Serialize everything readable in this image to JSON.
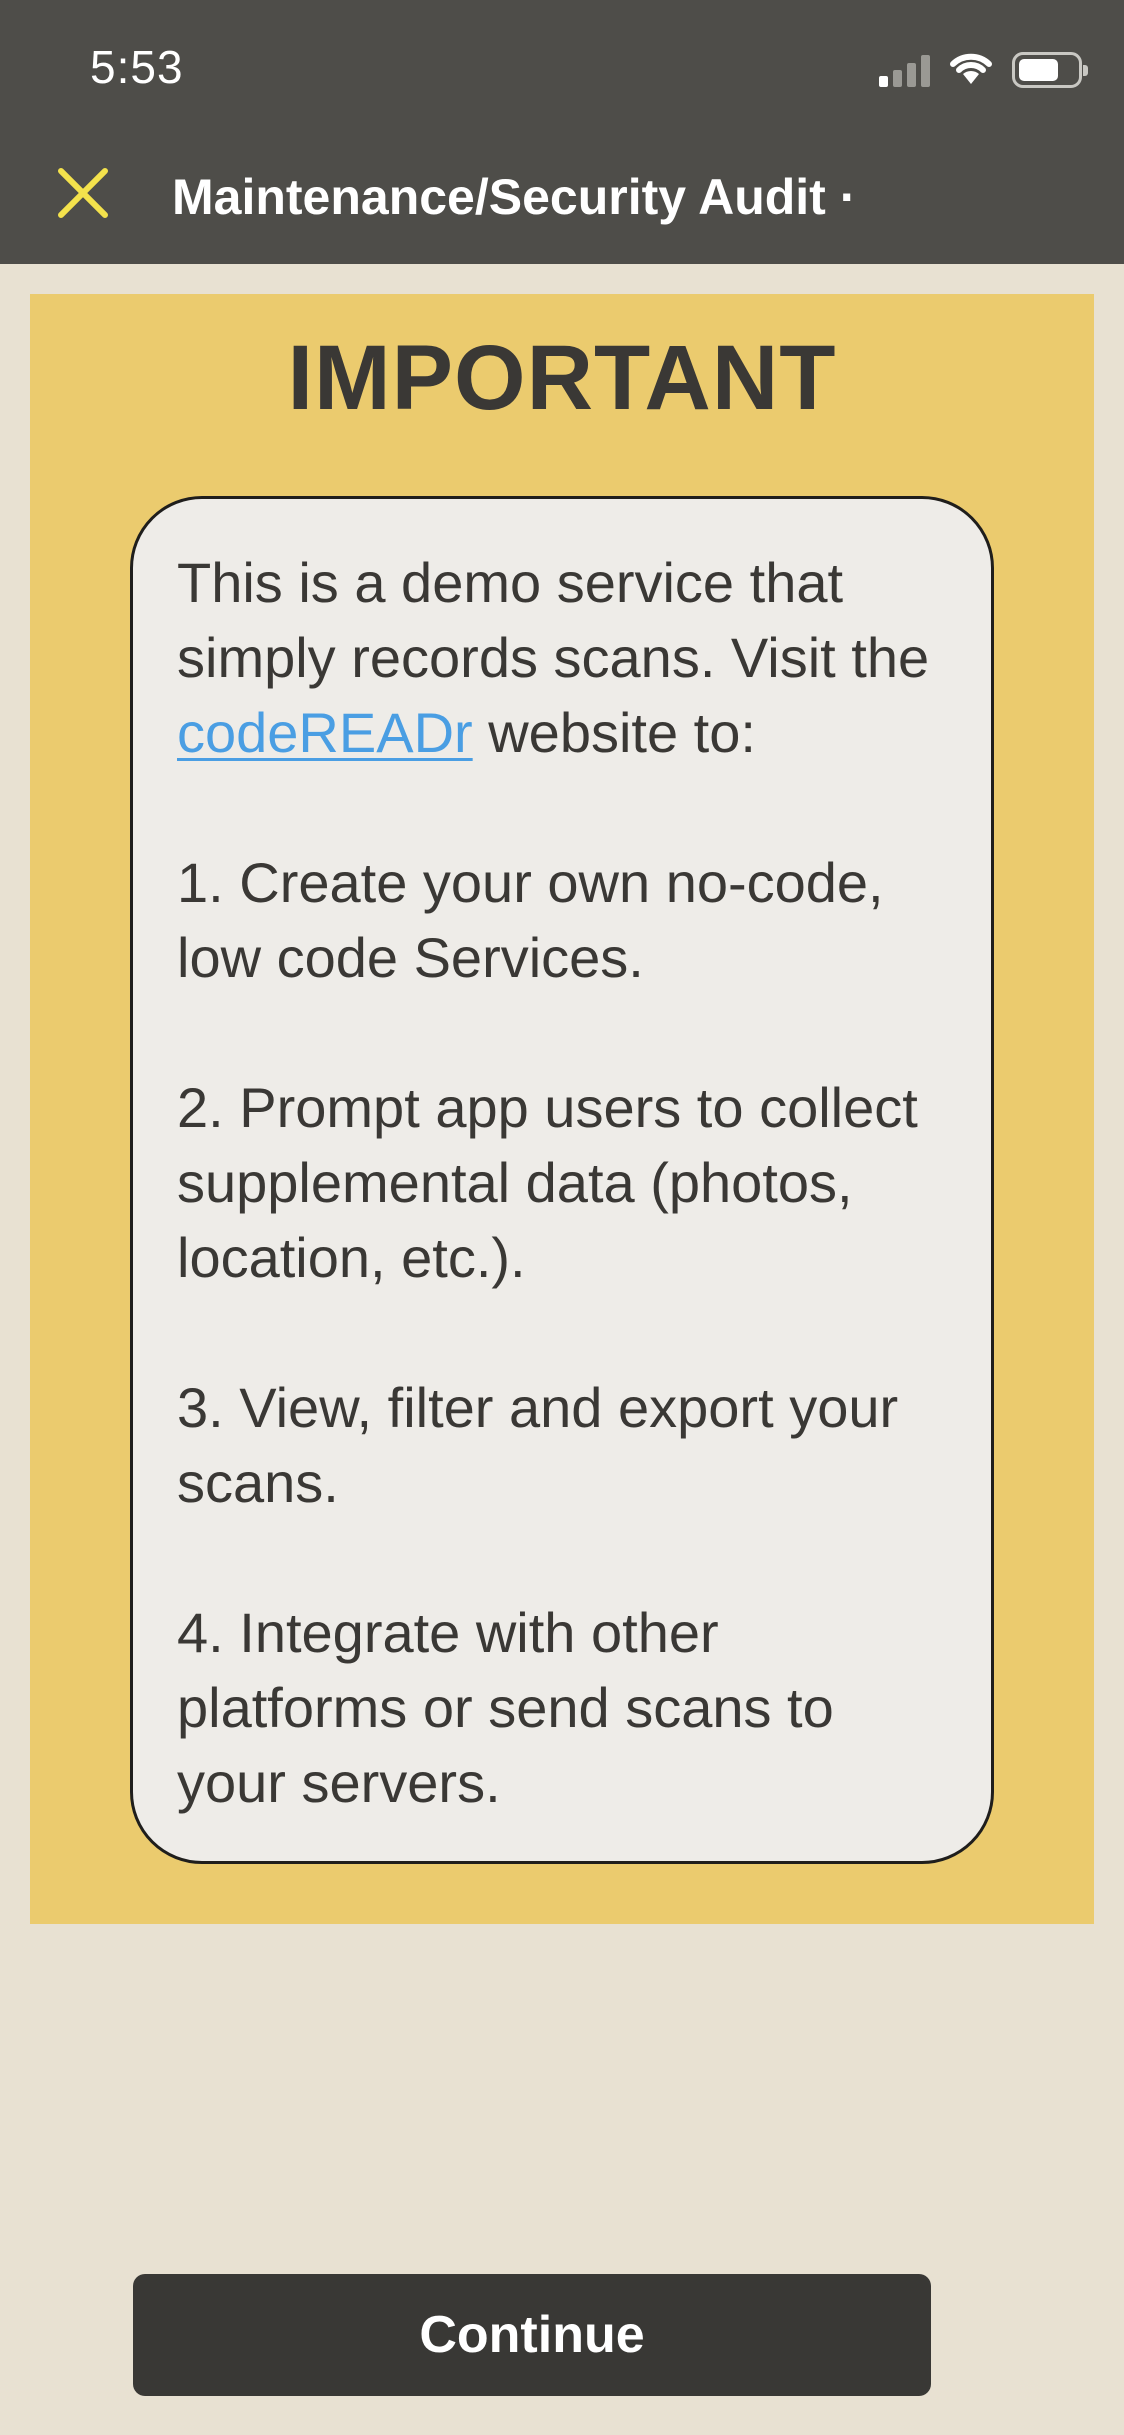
{
  "status_bar": {
    "time": "5:53",
    "signal_bars_active": 1,
    "battery_level": 0.7,
    "icons": [
      "signal-icon",
      "wifi-icon",
      "battery-icon"
    ]
  },
  "header": {
    "close_icon": "close-icon",
    "title": "Maintenance/Security Audit ·"
  },
  "notice": {
    "heading": "IMPORTANT",
    "intro_before_link": "This is a demo service that simply records scans. Visit the ",
    "link_text": "codeREADr",
    "intro_after_link": " website to:",
    "items": [
      "1. Create your own no-code, low code Services.",
      "2. Prompt app users to collect supplemental data (photos, location, etc.).",
      "3. View, filter and export your scans.",
      "4. Integrate with other platforms or send scans to your servers."
    ]
  },
  "footer": {
    "continue_label": "Continue"
  },
  "colors": {
    "topbar": "#4E4D49",
    "background": "#E8E1D2",
    "notice_panel": "#EBCB6E",
    "card": "#EEECE8",
    "close_icon": "#F4E24C",
    "link": "#4A9EE3",
    "button": "#393835"
  }
}
